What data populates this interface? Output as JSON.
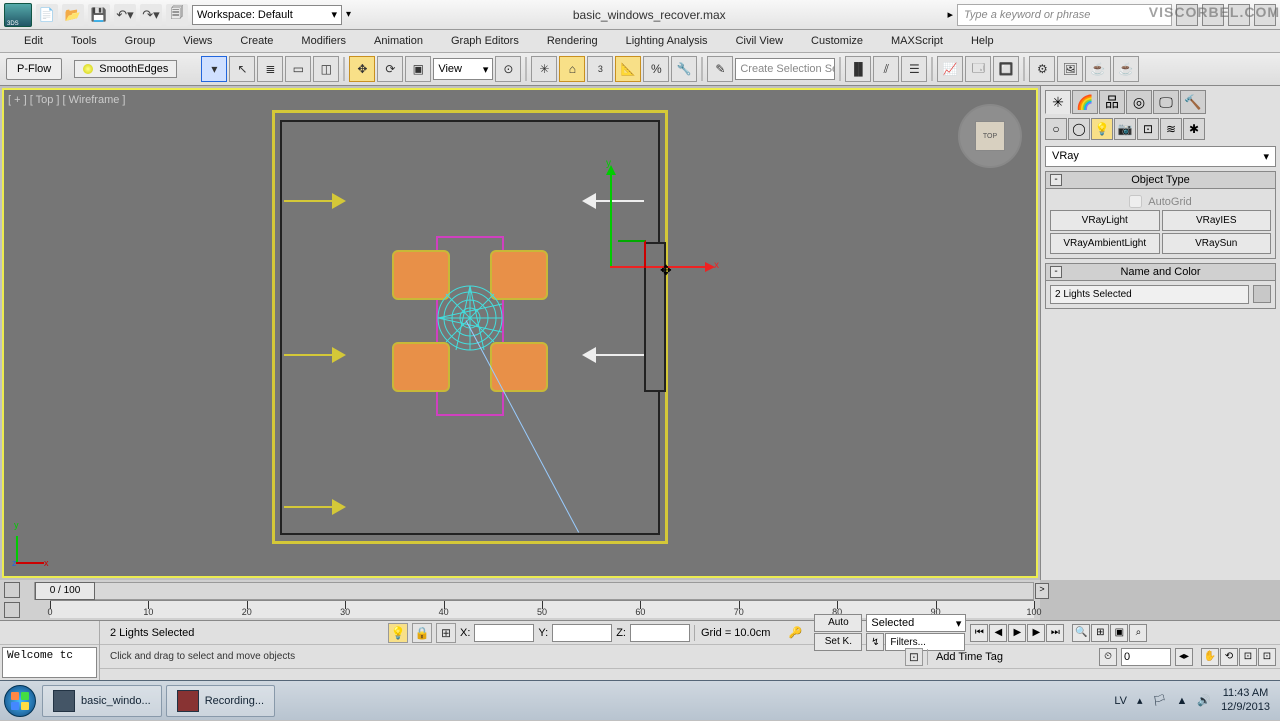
{
  "topbar": {
    "workspace_label": "Workspace: Default",
    "file_title": "basic_windows_recover.max",
    "search_placeholder": "Type a keyword or phrase"
  },
  "watermark": "VISCORBEL.COM",
  "menubar": [
    "Edit",
    "Tools",
    "Group",
    "Views",
    "Create",
    "Modifiers",
    "Animation",
    "Graph Editors",
    "Rendering",
    "Lighting Analysis",
    "Civil View",
    "Customize",
    "MAXScript",
    "Help"
  ],
  "toolbar2": {
    "pflow": "P-Flow",
    "smooth_edges": "SmoothEdges",
    "view_label": "View",
    "snap_number": "3",
    "create_sel_set": "Create Selection Se"
  },
  "viewport": {
    "label": "[ + ] [ Top ] [ Wireframe ]",
    "cube_face": "TOP",
    "axis_y": "y",
    "axis_x": "x",
    "gizmo_x": "x",
    "gizmo_y": "y"
  },
  "cmdpanel": {
    "dropdown": "VRay",
    "rollout_objtype": "Object Type",
    "autogrid": "AutoGrid",
    "buttons": [
      "VRayLight",
      "VRayIES",
      "VRayAmbientLight",
      "VRaySun"
    ],
    "rollout_name": "Name and Color",
    "name_value": "2 Lights Selected"
  },
  "timeline": {
    "thumb": "0 / 100",
    "ticks": [
      0,
      10,
      20,
      30,
      40,
      50,
      60,
      70,
      80,
      90,
      100
    ]
  },
  "status": {
    "selection": "2 Lights Selected",
    "x_label": "X:",
    "y_label": "Y:",
    "z_label": "Z:",
    "grid": "Grid = 10.0cm",
    "auto": "Auto",
    "setk": "Set K.",
    "selected": "Selected",
    "filters": "Filters...",
    "frame": "0",
    "welcome": "Welcome tc",
    "prompt": "Click and drag to select and move objects",
    "time_tag": "Add Time Tag"
  },
  "taskbar": {
    "tasks": [
      "basic_windo...",
      "Recording..."
    ],
    "lang": "LV",
    "time": "11:43 AM",
    "date": "12/9/2013"
  }
}
